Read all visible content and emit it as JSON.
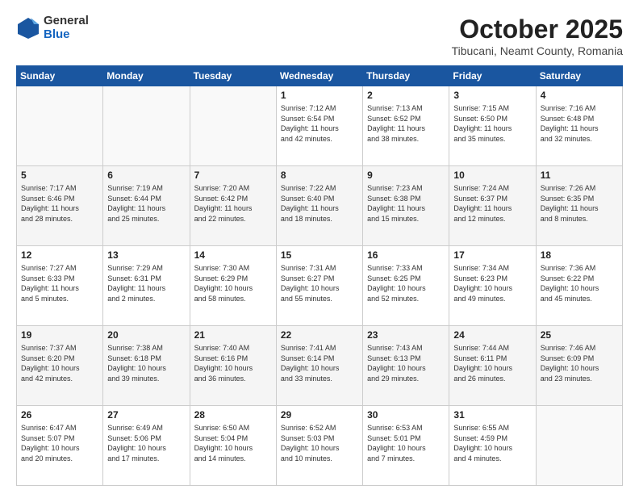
{
  "header": {
    "logo_general": "General",
    "logo_blue": "Blue",
    "month": "October 2025",
    "location": "Tibucani, Neamt County, Romania"
  },
  "weekdays": [
    "Sunday",
    "Monday",
    "Tuesday",
    "Wednesday",
    "Thursday",
    "Friday",
    "Saturday"
  ],
  "weeks": [
    [
      {
        "day": "",
        "info": ""
      },
      {
        "day": "",
        "info": ""
      },
      {
        "day": "",
        "info": ""
      },
      {
        "day": "1",
        "info": "Sunrise: 7:12 AM\nSunset: 6:54 PM\nDaylight: 11 hours\nand 42 minutes."
      },
      {
        "day": "2",
        "info": "Sunrise: 7:13 AM\nSunset: 6:52 PM\nDaylight: 11 hours\nand 38 minutes."
      },
      {
        "day": "3",
        "info": "Sunrise: 7:15 AM\nSunset: 6:50 PM\nDaylight: 11 hours\nand 35 minutes."
      },
      {
        "day": "4",
        "info": "Sunrise: 7:16 AM\nSunset: 6:48 PM\nDaylight: 11 hours\nand 32 minutes."
      }
    ],
    [
      {
        "day": "5",
        "info": "Sunrise: 7:17 AM\nSunset: 6:46 PM\nDaylight: 11 hours\nand 28 minutes."
      },
      {
        "day": "6",
        "info": "Sunrise: 7:19 AM\nSunset: 6:44 PM\nDaylight: 11 hours\nand 25 minutes."
      },
      {
        "day": "7",
        "info": "Sunrise: 7:20 AM\nSunset: 6:42 PM\nDaylight: 11 hours\nand 22 minutes."
      },
      {
        "day": "8",
        "info": "Sunrise: 7:22 AM\nSunset: 6:40 PM\nDaylight: 11 hours\nand 18 minutes."
      },
      {
        "day": "9",
        "info": "Sunrise: 7:23 AM\nSunset: 6:38 PM\nDaylight: 11 hours\nand 15 minutes."
      },
      {
        "day": "10",
        "info": "Sunrise: 7:24 AM\nSunset: 6:37 PM\nDaylight: 11 hours\nand 12 minutes."
      },
      {
        "day": "11",
        "info": "Sunrise: 7:26 AM\nSunset: 6:35 PM\nDaylight: 11 hours\nand 8 minutes."
      }
    ],
    [
      {
        "day": "12",
        "info": "Sunrise: 7:27 AM\nSunset: 6:33 PM\nDaylight: 11 hours\nand 5 minutes."
      },
      {
        "day": "13",
        "info": "Sunrise: 7:29 AM\nSunset: 6:31 PM\nDaylight: 11 hours\nand 2 minutes."
      },
      {
        "day": "14",
        "info": "Sunrise: 7:30 AM\nSunset: 6:29 PM\nDaylight: 10 hours\nand 58 minutes."
      },
      {
        "day": "15",
        "info": "Sunrise: 7:31 AM\nSunset: 6:27 PM\nDaylight: 10 hours\nand 55 minutes."
      },
      {
        "day": "16",
        "info": "Sunrise: 7:33 AM\nSunset: 6:25 PM\nDaylight: 10 hours\nand 52 minutes."
      },
      {
        "day": "17",
        "info": "Sunrise: 7:34 AM\nSunset: 6:23 PM\nDaylight: 10 hours\nand 49 minutes."
      },
      {
        "day": "18",
        "info": "Sunrise: 7:36 AM\nSunset: 6:22 PM\nDaylight: 10 hours\nand 45 minutes."
      }
    ],
    [
      {
        "day": "19",
        "info": "Sunrise: 7:37 AM\nSunset: 6:20 PM\nDaylight: 10 hours\nand 42 minutes."
      },
      {
        "day": "20",
        "info": "Sunrise: 7:38 AM\nSunset: 6:18 PM\nDaylight: 10 hours\nand 39 minutes."
      },
      {
        "day": "21",
        "info": "Sunrise: 7:40 AM\nSunset: 6:16 PM\nDaylight: 10 hours\nand 36 minutes."
      },
      {
        "day": "22",
        "info": "Sunrise: 7:41 AM\nSunset: 6:14 PM\nDaylight: 10 hours\nand 33 minutes."
      },
      {
        "day": "23",
        "info": "Sunrise: 7:43 AM\nSunset: 6:13 PM\nDaylight: 10 hours\nand 29 minutes."
      },
      {
        "day": "24",
        "info": "Sunrise: 7:44 AM\nSunset: 6:11 PM\nDaylight: 10 hours\nand 26 minutes."
      },
      {
        "day": "25",
        "info": "Sunrise: 7:46 AM\nSunset: 6:09 PM\nDaylight: 10 hours\nand 23 minutes."
      }
    ],
    [
      {
        "day": "26",
        "info": "Sunrise: 6:47 AM\nSunset: 5:07 PM\nDaylight: 10 hours\nand 20 minutes."
      },
      {
        "day": "27",
        "info": "Sunrise: 6:49 AM\nSunset: 5:06 PM\nDaylight: 10 hours\nand 17 minutes."
      },
      {
        "day": "28",
        "info": "Sunrise: 6:50 AM\nSunset: 5:04 PM\nDaylight: 10 hours\nand 14 minutes."
      },
      {
        "day": "29",
        "info": "Sunrise: 6:52 AM\nSunset: 5:03 PM\nDaylight: 10 hours\nand 10 minutes."
      },
      {
        "day": "30",
        "info": "Sunrise: 6:53 AM\nSunset: 5:01 PM\nDaylight: 10 hours\nand 7 minutes."
      },
      {
        "day": "31",
        "info": "Sunrise: 6:55 AM\nSunset: 4:59 PM\nDaylight: 10 hours\nand 4 minutes."
      },
      {
        "day": "",
        "info": ""
      }
    ]
  ]
}
